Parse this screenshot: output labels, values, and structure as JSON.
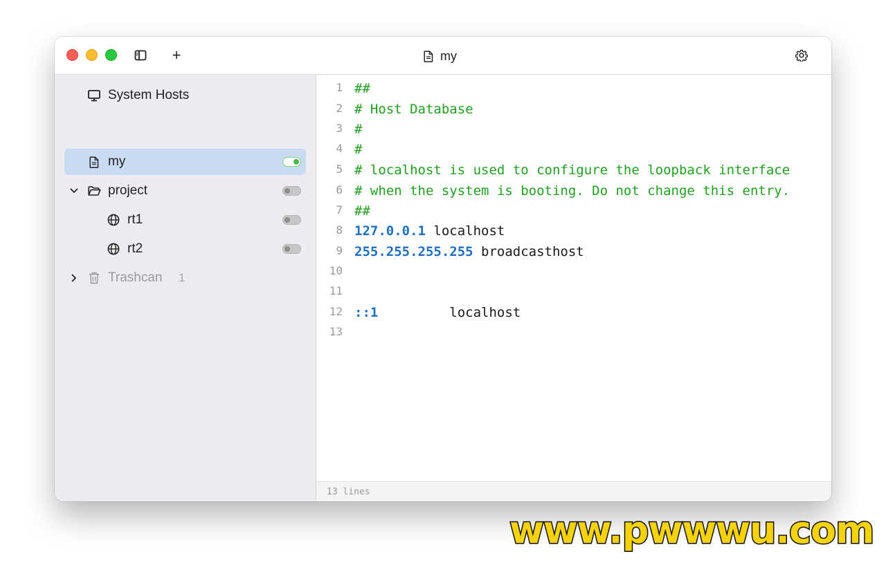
{
  "window": {
    "title": "my"
  },
  "toolbar": {
    "sidebar_toggle_icon": "sidebar-icon",
    "add_label": "+",
    "settings_icon": "gear-icon"
  },
  "sidebar": {
    "items": [
      {
        "label": "System Hosts",
        "icon": "monitor-icon"
      },
      {
        "label": "my",
        "icon": "document-icon",
        "enabled": true,
        "selected": true
      },
      {
        "label": "project",
        "icon": "folder-open-icon",
        "enabled": false,
        "expanded": true
      },
      {
        "label": "rt1",
        "icon": "globe-icon",
        "enabled": false
      },
      {
        "label": "rt2",
        "icon": "globe-icon",
        "enabled": false
      },
      {
        "label": "Trashcan",
        "icon": "trash-icon",
        "count": "1",
        "expanded": false
      }
    ]
  },
  "editor": {
    "lines": [
      {
        "n": "1",
        "comment": "##"
      },
      {
        "n": "2",
        "comment": "# Host Database"
      },
      {
        "n": "3",
        "comment": "#"
      },
      {
        "n": "4",
        "comment": "#"
      },
      {
        "n": "5",
        "comment": "# localhost is used to configure the loopback interface"
      },
      {
        "n": "6",
        "comment": "# when the system is booting. Do not change this entry."
      },
      {
        "n": "7",
        "comment": "##"
      },
      {
        "n": "8",
        "ip": "127.0.0.1",
        "host": " localhost"
      },
      {
        "n": "9",
        "ip": "255.255.255.255",
        "host": " broadcasthost"
      },
      {
        "n": "10"
      },
      {
        "n": "11"
      },
      {
        "n": "12",
        "ip": "::1",
        "host": "         localhost"
      },
      {
        "n": "13"
      }
    ]
  },
  "status": {
    "text": "13 lines"
  },
  "watermark": {
    "text": "www.pwwwu.com"
  },
  "colors": {
    "comment": "#22a022",
    "ip": "#1f6fc0",
    "selection": "#c9dbf2",
    "toggle_on": "#4cb84c"
  }
}
